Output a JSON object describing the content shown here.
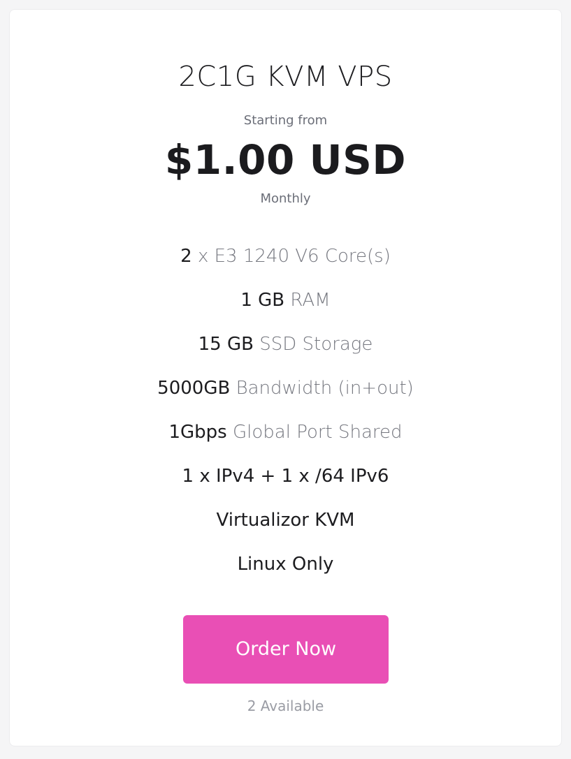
{
  "product": {
    "title": "2C1G KVM VPS",
    "starting_label": "Starting from",
    "price": "$1.00 USD",
    "billing_cycle": "Monthly"
  },
  "features": [
    {
      "value": "2",
      "label": "x E3 1240 V6 Core(s)"
    },
    {
      "value": "1 GB",
      "label": "RAM"
    },
    {
      "value": "15 GB",
      "label": "SSD Storage"
    },
    {
      "value": "5000GB",
      "label": "Bandwidth (in+out)"
    },
    {
      "value": "1Gbps",
      "label": "Global Port Shared"
    },
    {
      "value": "1 x IPv4 + 1 x /64 IPv6",
      "label": ""
    },
    {
      "value": "Virtualizor KVM",
      "label": ""
    },
    {
      "value": "Linux Only",
      "label": ""
    }
  ],
  "action": {
    "order_label": "Order Now",
    "availability": "2 Available"
  },
  "colors": {
    "accent": "#e94fb5",
    "muted_text": "#75777f",
    "background": "#f5f5f6"
  }
}
